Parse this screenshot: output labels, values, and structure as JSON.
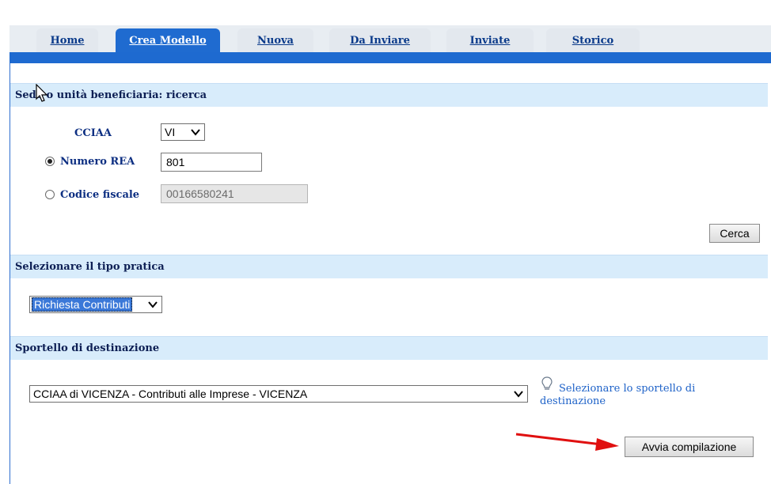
{
  "tabs": [
    {
      "label": "Home"
    },
    {
      "label": "Crea Modello"
    },
    {
      "label": "Nuova"
    },
    {
      "label": "Da Inviare"
    },
    {
      "label": "Inviate"
    },
    {
      "label": "Storico"
    }
  ],
  "active_tab": "Crea Modello",
  "section_search": {
    "title": "Sede o unità beneficiaria: ricerca",
    "cciaa_label": "CCIAA",
    "cciaa_value": "VI",
    "rea_label": "Numero REA",
    "rea_value": "801",
    "cf_label": "Codice fiscale",
    "cf_value": "00166580241",
    "search_button": "Cerca"
  },
  "section_type": {
    "title": "Selezionare il tipo pratica",
    "selected": "Richiesta Contributi"
  },
  "section_desk": {
    "title": "Sportello di destinazione",
    "selected": "CCIAA di VICENZA - Contributi alle Imprese - VICENZA",
    "hint": "Selezionare lo sportello di destinazione",
    "start_button": "Avvia compilazione"
  },
  "colors": {
    "tab_active": "#1f6bd0",
    "header_band": "#d8ecfb",
    "link_blue": "#1e62c8",
    "arrow_red": "#e01010"
  }
}
